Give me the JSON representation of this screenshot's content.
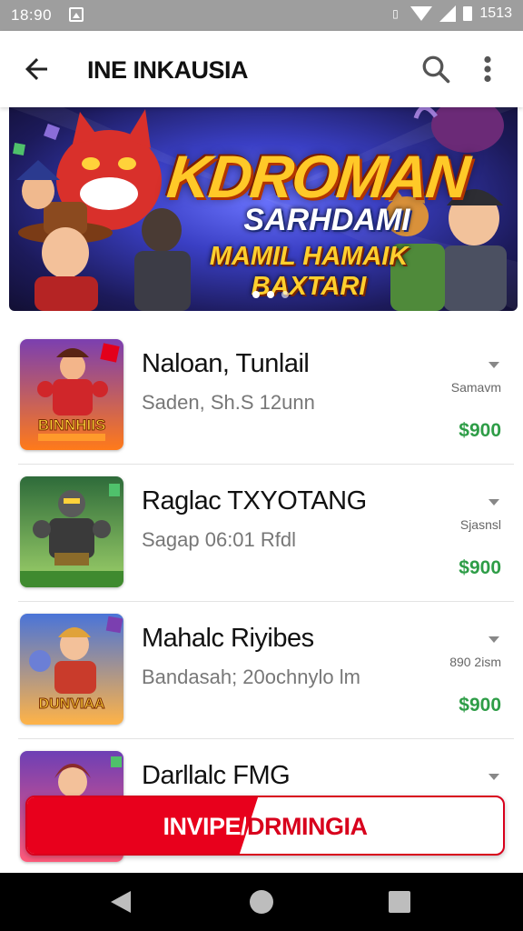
{
  "status_bar": {
    "time": "18:90",
    "battery_text": "1513",
    "icons": [
      "image-icon",
      "vibrate-icon",
      "wifi-icon",
      "signal-icon",
      "battery-icon"
    ]
  },
  "app_bar": {
    "title": "INE INKAUSIA",
    "icons": [
      "back-arrow-icon",
      "search-icon",
      "more-vert-icon"
    ]
  },
  "banner": {
    "title": "KDROMAN",
    "subtitle": "SARHDAMI",
    "tagline": "MAMIL HAMAIK BAXTARI",
    "dots": 3,
    "active_dot": 2
  },
  "items": [
    {
      "title": "Naloan, Tunlail",
      "subtitle": "Saden, Sh.S 12unn",
      "meta": "Samavm",
      "price": "$900",
      "thumb_label": "BINNHIIS",
      "colors": [
        "#7b3fb0",
        "#ff7a1a",
        "#d0262a"
      ]
    },
    {
      "title": "Raglac TXYOTANG",
      "subtitle": "Sagap 06:01 Rfdl",
      "meta": "Sjasnsl",
      "price": "$900",
      "thumb_label": "",
      "colors": [
        "#3b8a3a",
        "#9fd26a",
        "#3a3a3a"
      ]
    },
    {
      "title": "Mahalc Riyibes",
      "subtitle": "Bandasah; 20ochnylo lm",
      "meta": "890 2ism",
      "price": "$900",
      "thumb_label": "DUNVIAA",
      "colors": [
        "#4a74d8",
        "#ffb347",
        "#c93b2b"
      ]
    },
    {
      "title": "Darllalc FMG",
      "subtitle": "",
      "meta": "",
      "price": "",
      "thumb_label": "",
      "colors": [
        "#6d3fb5",
        "#ff5a7a",
        "#8a2b2b"
      ]
    }
  ],
  "cta": {
    "label": "INVIPE/DRMINGIA"
  },
  "nav_bar": {
    "icons": [
      "nav-back-icon",
      "nav-home-icon",
      "nav-recents-icon"
    ]
  }
}
